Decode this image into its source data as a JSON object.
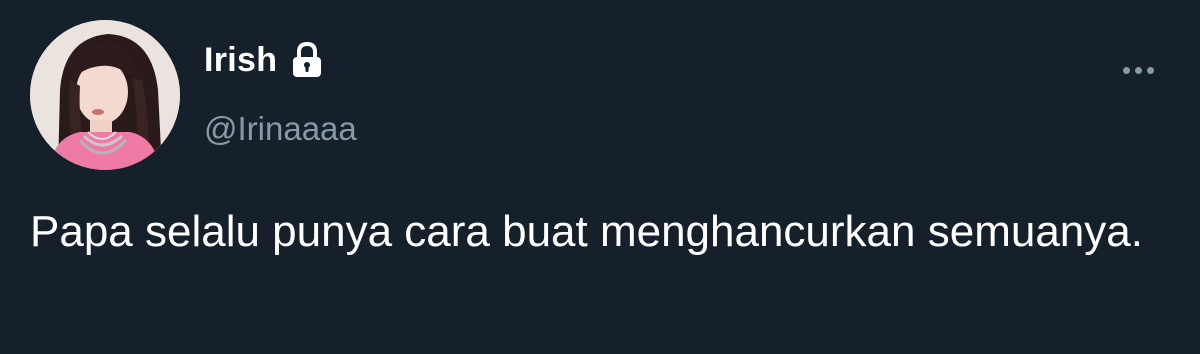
{
  "tweet": {
    "author": {
      "display_name": "Irish",
      "handle": "@Irinaaaa",
      "protected": true,
      "avatar_icon": "profile-photo"
    },
    "text": "Papa selalu punya cara buat menghancurkan semuanya.",
    "more_icon": "ellipsis-icon"
  },
  "colors": {
    "background": "#15202b",
    "primary_text": "#ffffff",
    "secondary_text": "#8899a6"
  }
}
